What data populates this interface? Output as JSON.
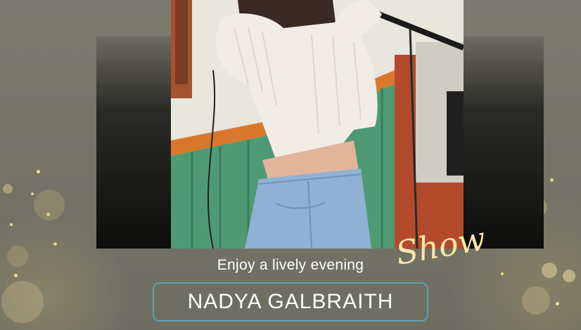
{
  "script_word": "Show",
  "tagline": "Enjoy a lively evening",
  "performer_name": "NADYA GALBRAITH",
  "colors": {
    "background": "#7b7a6d",
    "name_border": "#5f9fb0",
    "script_gold": "#f7e6a8",
    "text": "#ffffff"
  }
}
